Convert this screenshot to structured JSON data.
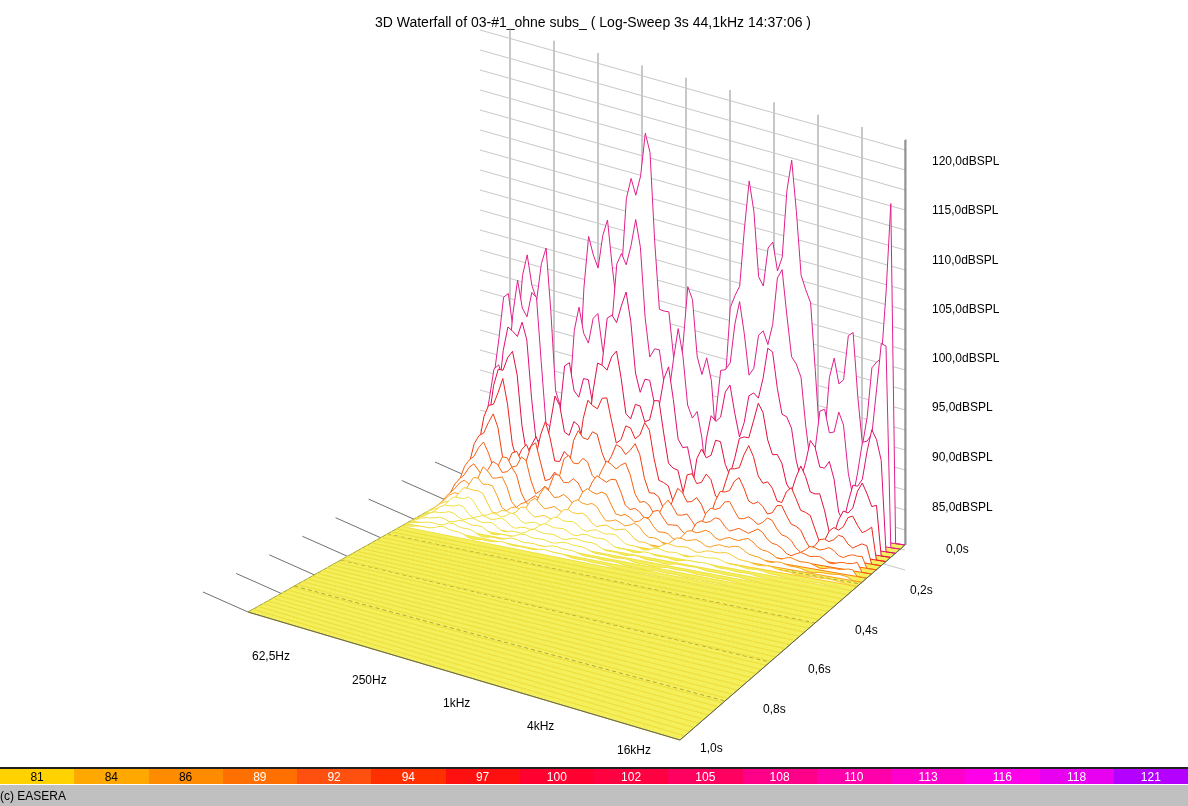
{
  "title": "3D Waterfall of 03-#1_ohne subs_ ( Log-Sweep 3s 44,1kHz 14:37:06 )",
  "level_axis_labels": [
    "120,0dBSPL",
    "115,0dBSPL",
    "110,0dBSPL",
    "105,0dBSPL",
    "100,0dBSPL",
    "95,0dBSPL",
    "90,0dBSPL",
    "85,0dBSPL"
  ],
  "time_axis_labels": [
    "0,0s",
    "0,2s",
    "0,4s",
    "0,6s",
    "0,8s",
    "1,0s"
  ],
  "frequency_axis_labels": [
    "62,5Hz",
    "250Hz",
    "1kHz",
    "4kHz",
    "16kHz"
  ],
  "color_scale": [
    {
      "label": "81",
      "color": "#ffd200"
    },
    {
      "label": "84",
      "color": "#ffa800"
    },
    {
      "label": "86",
      "color": "#ff8c00"
    },
    {
      "label": "89",
      "color": "#ff7000"
    },
    {
      "label": "92",
      "color": "#ff5010"
    },
    {
      "label": "94",
      "color": "#ff3000"
    },
    {
      "label": "97",
      "color": "#ff1010"
    },
    {
      "label": "100",
      "color": "#ff0030"
    },
    {
      "label": "102",
      "color": "#ff0040"
    },
    {
      "label": "105",
      "color": "#ff0060"
    },
    {
      "label": "108",
      "color": "#ff0088"
    },
    {
      "label": "110",
      "color": "#ff00aa"
    },
    {
      "label": "113",
      "color": "#ff00cc"
    },
    {
      "label": "116",
      "color": "#ff00e8"
    },
    {
      "label": "118",
      "color": "#e800f0"
    },
    {
      "label": "121",
      "color": "#b400ff"
    }
  ],
  "status_bar": "(c) EASERA"
}
